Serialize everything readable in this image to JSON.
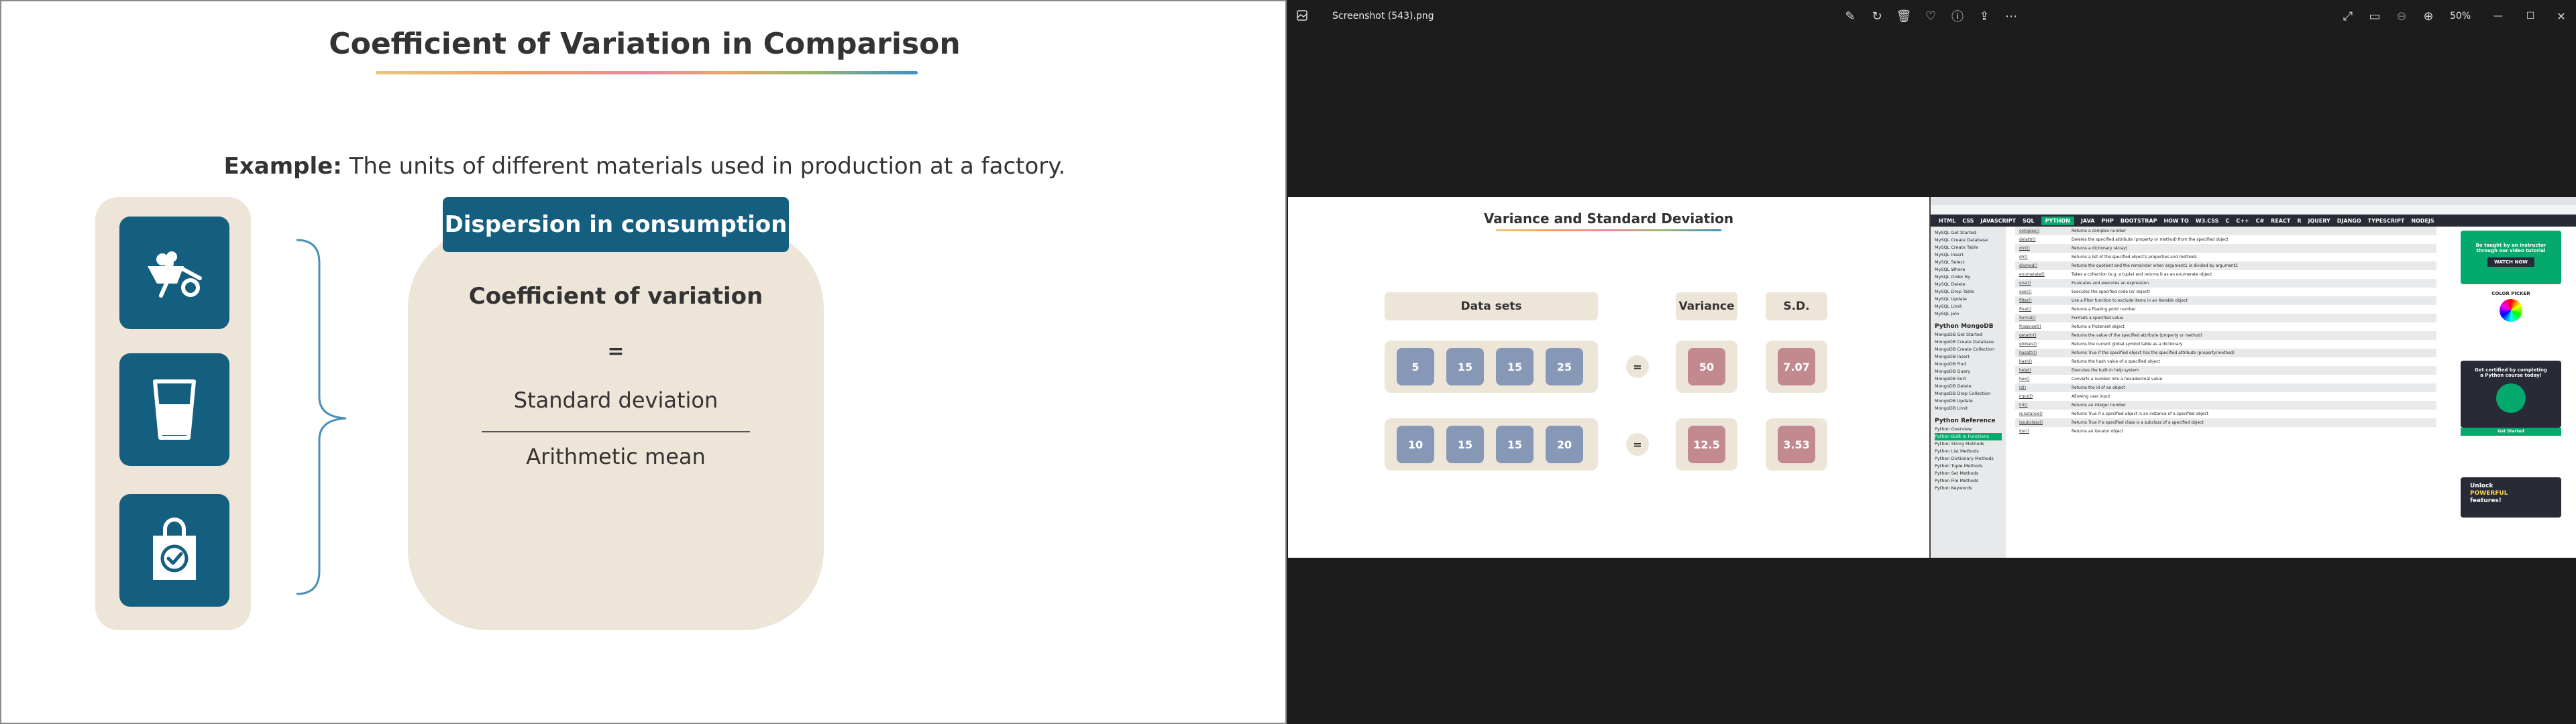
{
  "slide": {
    "title": "Coefficient of Variation in Comparison",
    "example_label": "Example:",
    "example_text": "The units of different materials used in production at a factory.",
    "icons": [
      "wheelbarrow-icon",
      "water-glass-icon",
      "shopping-bag-check-icon"
    ],
    "badge": "Dispersion in consumption",
    "formula_title": "Coefficient of variation",
    "equals": "=",
    "numerator": "Standard deviation",
    "denominator": "Arithmetic mean",
    "colors": {
      "teal": "#145f80",
      "beige": "#ede5d8"
    }
  },
  "viewer": {
    "file_name": "Screenshot (543).png",
    "zoom": "50%",
    "tools": [
      "edit-icon",
      "rotate-icon",
      "delete-icon",
      "favorite-icon",
      "info-icon",
      "share-icon",
      "more-icon"
    ],
    "right_tools": [
      "fullscreen-icon",
      "slideshow-icon",
      "zoom-out-icon",
      "zoom-in-icon"
    ],
    "window_controls": [
      "minimize-icon",
      "maximize-icon",
      "close-icon"
    ]
  },
  "image": {
    "title": "Variance and Standard Deviation",
    "headers": {
      "datasets": "Data sets",
      "variance": "Variance",
      "sd": "S.D."
    },
    "equals": "=",
    "rows": [
      {
        "values": [
          "5",
          "15",
          "15",
          "25"
        ],
        "variance": "50",
        "sd": "7.07"
      },
      {
        "values": [
          "10",
          "15",
          "15",
          "20"
        ],
        "variance": "12.5",
        "sd": "3.53"
      }
    ]
  },
  "w3": {
    "nav": [
      "HTML",
      "CSS",
      "JAVASCRIPT",
      "SQL",
      "PYTHON",
      "JAVA",
      "PHP",
      "BOOTSTRAP",
      "HOW TO",
      "W3.CSS",
      "C",
      "C++",
      "C#",
      "REACT",
      "R",
      "JQUERY",
      "DJANGO",
      "TYPESCRIPT",
      "NODEJS"
    ],
    "active_nav": "PYTHON",
    "sidebar": [
      {
        "t": "MySQL Get Started"
      },
      {
        "t": "MySQL Create Database"
      },
      {
        "t": "MySQL Create Table"
      },
      {
        "t": "MySQL Insert"
      },
      {
        "t": "MySQL Select"
      },
      {
        "t": "MySQL Where"
      },
      {
        "t": "MySQL Order By"
      },
      {
        "t": "MySQL Delete"
      },
      {
        "t": "MySQL Drop Table"
      },
      {
        "t": "MySQL Update"
      },
      {
        "t": "MySQL Limit"
      },
      {
        "t": "MySQL Join"
      },
      {
        "t": "Python MongoDB",
        "h": true
      },
      {
        "t": "MongoDB Get Started"
      },
      {
        "t": "MongoDB Create Database"
      },
      {
        "t": "MongoDB Create Collection"
      },
      {
        "t": "MongoDB Insert"
      },
      {
        "t": "MongoDB Find"
      },
      {
        "t": "MongoDB Query"
      },
      {
        "t": "MongoDB Sort"
      },
      {
        "t": "MongoDB Delete"
      },
      {
        "t": "MongoDB Drop Collection"
      },
      {
        "t": "MongoDB Update"
      },
      {
        "t": "MongoDB Limit"
      },
      {
        "t": "Python Reference",
        "h": true
      },
      {
        "t": "Python Overview"
      },
      {
        "t": "Python Built-in Functions",
        "a": true
      },
      {
        "t": "Python String Methods"
      },
      {
        "t": "Python List Methods"
      },
      {
        "t": "Python Dictionary Methods"
      },
      {
        "t": "Python Tuple Methods"
      },
      {
        "t": "Python Set Methods"
      },
      {
        "t": "Python File Methods"
      },
      {
        "t": "Python Keywords"
      }
    ],
    "table": [
      [
        "complex()",
        "Returns a complex number"
      ],
      [
        "delattr()",
        "Deletes the specified attribute (property or method) from the specified object"
      ],
      [
        "dict()",
        "Returns a dictionary (Array)"
      ],
      [
        "dir()",
        "Returns a list of the specified object's properties and methods"
      ],
      [
        "divmod()",
        "Returns the quotient and the remainder when argument1 is divided by argument2"
      ],
      [
        "enumerate()",
        "Takes a collection (e.g. a tuple) and returns it as an enumerate object"
      ],
      [
        "eval()",
        "Evaluates and executes an expression"
      ],
      [
        "exec()",
        "Executes the specified code (or object)"
      ],
      [
        "filter()",
        "Use a filter function to exclude items in an iterable object"
      ],
      [
        "float()",
        "Returns a floating point number"
      ],
      [
        "format()",
        "Formats a specified value"
      ],
      [
        "frozenset()",
        "Returns a frozenset object"
      ],
      [
        "getattr()",
        "Returns the value of the specified attribute (property or method)"
      ],
      [
        "globals()",
        "Returns the current global symbol table as a dictionary"
      ],
      [
        "hasattr()",
        "Returns True if the specified object has the specified attribute (property/method)"
      ],
      [
        "hash()",
        "Returns the hash value of a specified object"
      ],
      [
        "help()",
        "Executes the built-in help system"
      ],
      [
        "hex()",
        "Converts a number into a hexadecimal value"
      ],
      [
        "id()",
        "Returns the id of an object"
      ],
      [
        "input()",
        "Allowing user input"
      ],
      [
        "int()",
        "Returns an integer number"
      ],
      [
        "isinstance()",
        "Returns True if a specified object is an instance of a specified object"
      ],
      [
        "issubclass()",
        "Returns True if a specified class is a subclass of a specified object"
      ],
      [
        "iter()",
        "Returns an iterator object"
      ]
    ],
    "ad": {
      "top": "Be taught by an Instructor through our video tutorial",
      "watch": "WATCH NOW",
      "picker": "COLOR PICKER",
      "cert": "Get certified by completing a Python course today!",
      "started": "Get Started",
      "unlock1": "Unlock",
      "unlock2": "POWERFUL",
      "unlock3": "features!"
    }
  }
}
